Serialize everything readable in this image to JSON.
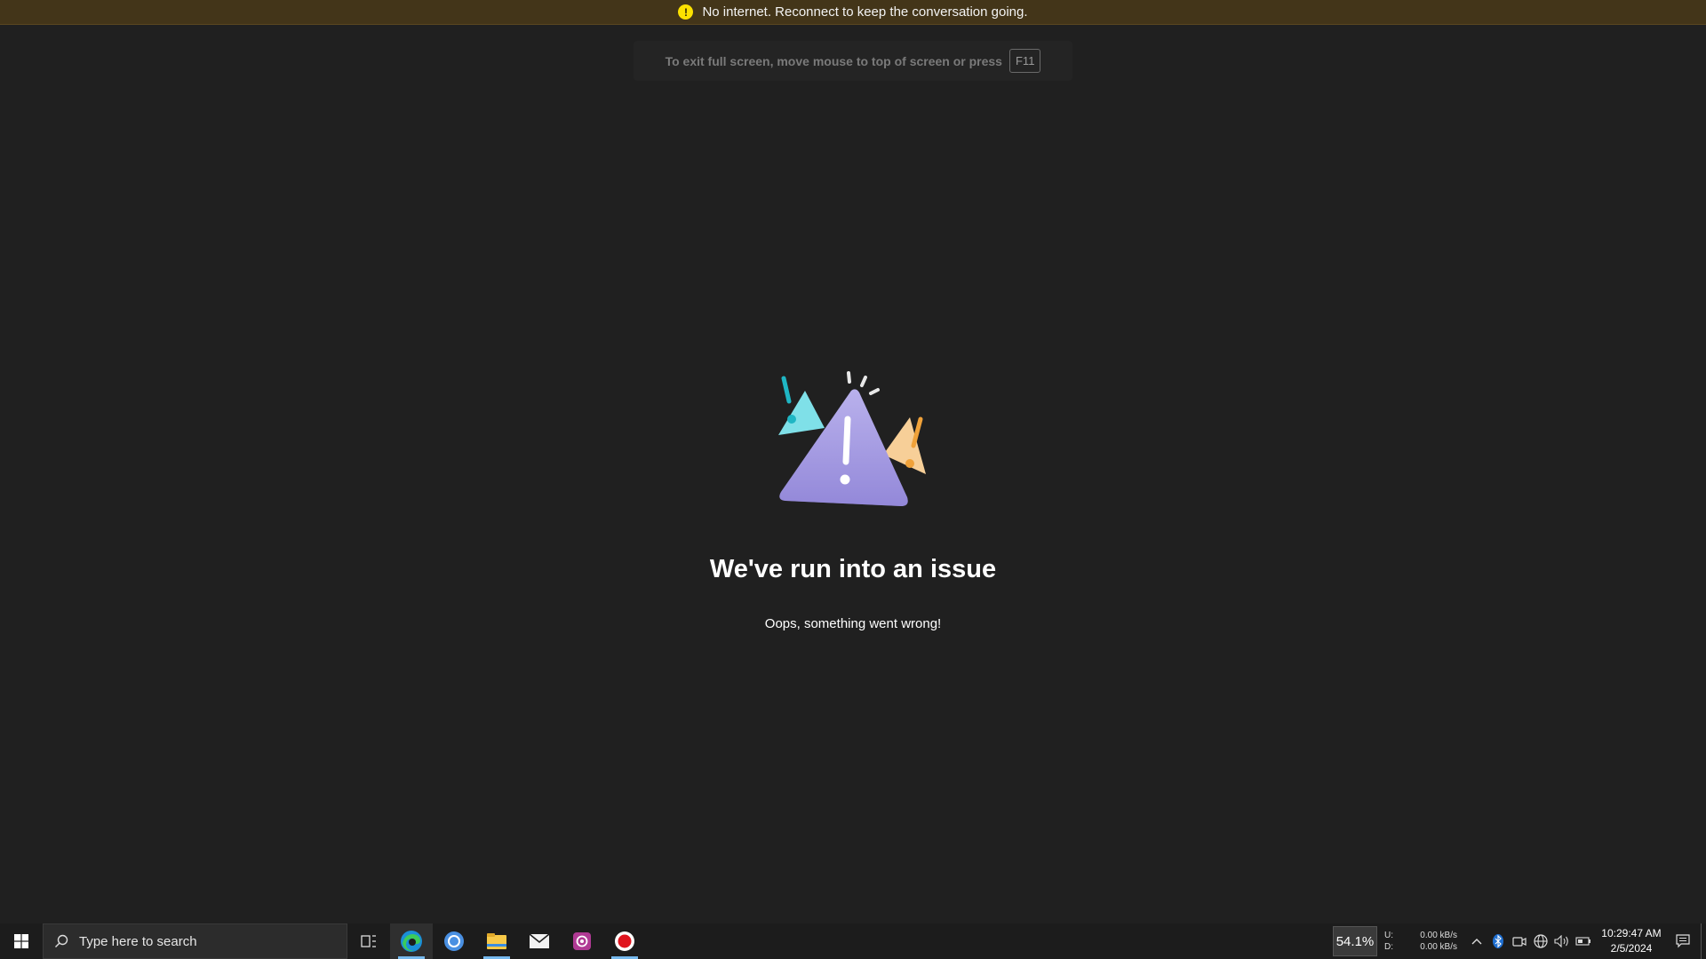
{
  "banner": {
    "icon": "warning-icon",
    "message": "No internet. Reconnect to keep the conversation going."
  },
  "fullscreen_hint": {
    "text": "To exit full screen, move mouse to top of screen or press",
    "key": "F11"
  },
  "error": {
    "illustration": "warning-triangle-illustration",
    "title": "We've run into an issue",
    "subtitle": "Oops, something went wrong!"
  },
  "taskbar": {
    "search_placeholder": "Type here to search",
    "apps": [
      {
        "name": "task-view-icon"
      },
      {
        "name": "edge-icon",
        "active": true
      },
      {
        "name": "chrome-icon"
      },
      {
        "name": "file-explorer-icon"
      },
      {
        "name": "mail-icon"
      },
      {
        "name": "photo-app-icon"
      },
      {
        "name": "record-icon"
      }
    ],
    "cpu_percent": "54.1%",
    "net": {
      "up_label": "U:",
      "down_label": "D:",
      "up_value": "0.00 kB/s",
      "down_value": "0.00 kB/s"
    },
    "clock": {
      "time": "10:29:47 AM",
      "date": "2/5/2024"
    }
  },
  "colors": {
    "background": "#202020",
    "banner": "#433519",
    "taskbar": "#1c1c1c",
    "accent": "#76b9ed"
  }
}
